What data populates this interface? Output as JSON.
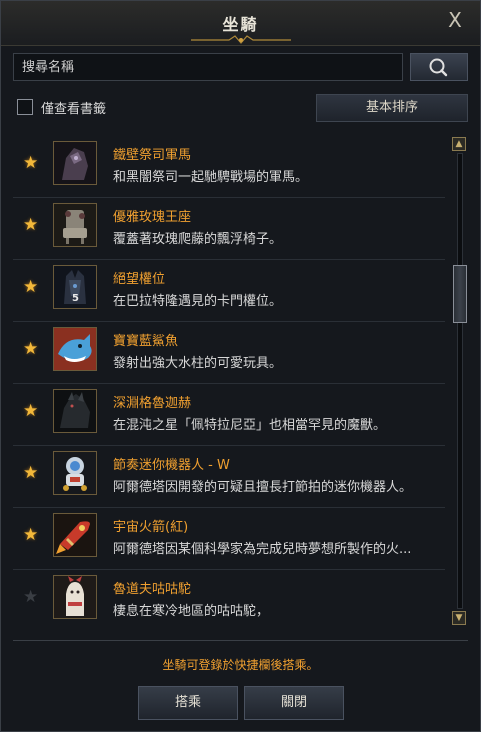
{
  "window": {
    "title": "坐騎",
    "close_glyph": "X"
  },
  "search": {
    "placeholder": "搜尋名稱",
    "value": ""
  },
  "filter": {
    "bookmark_only_label": "僅查看書籤",
    "bookmark_only_checked": false,
    "sort_label": "基本排序"
  },
  "mounts": [
    {
      "name": "鐵壁祭司軍馬",
      "desc": "和黑闇祭司一起馳騁戰場的軍馬。",
      "bookmarked": true,
      "icon": "dark-armored-horse-icon"
    },
    {
      "name": "優雅玫瑰王座",
      "desc": "覆蓋著玫瑰爬藤的飄浮椅子。",
      "bookmarked": true,
      "icon": "rose-throne-icon"
    },
    {
      "name": "絕望權位",
      "desc": "在巴拉特隆遇見的卡門權位。",
      "bookmarked": true,
      "icon": "despair-throne-icon",
      "badge": "5"
    },
    {
      "name": "寶寶藍鯊魚",
      "desc": "發射出強大水柱的可愛玩具。",
      "bookmarked": true,
      "icon": "blue-shark-icon"
    },
    {
      "name": "深淵格魯迦赫",
      "desc": "在混沌之星「佩特拉尼亞」也相當罕見的魔獸。",
      "bookmarked": true,
      "icon": "abyss-beast-icon"
    },
    {
      "name": "節奏迷你機器人 - W",
      "desc": "阿爾德塔因開發的可疑且擅長打節拍的迷你機器人。",
      "bookmarked": true,
      "icon": "mini-robot-icon"
    },
    {
      "name": "宇宙火箭(紅)",
      "desc": "阿爾德塔因某個科學家為完成兒時夢想所製作的火...",
      "bookmarked": true,
      "icon": "red-rocket-icon"
    },
    {
      "name": "魯道夫咕咕駝",
      "desc": "棲息在寒冷地區的咕咕駝，",
      "bookmarked": false,
      "icon": "white-camel-icon"
    }
  ],
  "scrollbar": {
    "up_glyph": "▲",
    "down_glyph": "▼"
  },
  "footer": {
    "note": "坐騎可登錄於快捷欄後搭乘。",
    "ride_label": "搭乘",
    "close_label": "關閉"
  },
  "star_glyph": "★",
  "colors": {
    "accent": "#f0a030",
    "star_on": "#f2b83a",
    "star_off": "#3a3e44"
  }
}
